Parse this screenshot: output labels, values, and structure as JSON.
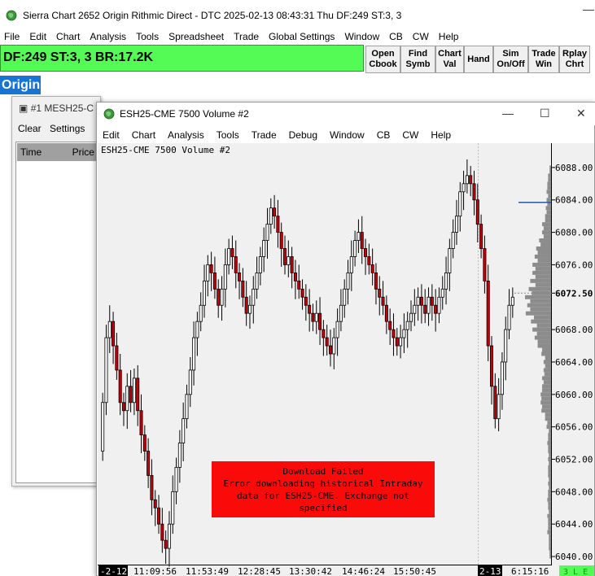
{
  "app": {
    "title": "Sierra Chart 2652 Origin Rithmic Direct - DTC 2025-02-13  08:43:31 Thu DF:249  ST:3, 3",
    "minimize_glyph": "—"
  },
  "menu": [
    "File",
    "Edit",
    "Chart",
    "Analysis",
    "Tools",
    "Spreadsheet",
    "Trade",
    "Global Settings",
    "Window",
    "CB",
    "CW",
    "Help"
  ],
  "status_bar": {
    "text": "DF:249  ST:3, 3  BR:17.2K",
    "color": "#55fb55"
  },
  "toolbar": [
    {
      "label": "Open\nCbook",
      "name": "open-cbook-button"
    },
    {
      "label": "Find\nSymb",
      "name": "find-symb-button"
    },
    {
      "label": "Chart\nVal",
      "name": "chart-val-button"
    },
    {
      "label": "Hand",
      "name": "hand-button"
    },
    {
      "label": "Sim\nOn/Off",
      "name": "sim-onoff-button"
    },
    {
      "label": "Trade\nWin",
      "name": "trade-win-button"
    },
    {
      "label": "Rplay\nChrt",
      "name": "rplay-chrt-button"
    }
  ],
  "origin_label": "Origin",
  "window1": {
    "title": "#1 MESH25-C",
    "menu": [
      "Clear",
      "Settings"
    ],
    "columns": [
      "Time",
      "Price"
    ]
  },
  "window2": {
    "title": "ESH25-CME  7500 Volume #2",
    "menu": [
      "Edit",
      "Chart",
      "Analysis",
      "Tools",
      "Trade",
      "Debug",
      "Window",
      "CB",
      "CW",
      "Help"
    ],
    "buttons": {
      "minimize": "—",
      "maximize": "☐",
      "close": "✕"
    }
  },
  "chart_data": {
    "type": "candlestick",
    "title": "ESH25-CME  7500 Volume #2",
    "price_labels": [
      "6088.00",
      "6084.00",
      "6080.00",
      "6076.00",
      "6072.50",
      "6068.00",
      "6064.00",
      "6060.00",
      "6056.00",
      "6052.00",
      "6048.00",
      "6044.00",
      "6040.00"
    ],
    "current_price": "6072.50",
    "ylim": [
      6039,
      6091
    ],
    "time_labels": [
      "-2-12",
      "11:09:56",
      "11:53:49",
      "12:28:45",
      "13:30:42",
      "14:46:24",
      "15:50:45",
      "2-13",
      "6:15:16"
    ],
    "status_right": "3 L E",
    "error_box": {
      "line1": "Download Failed",
      "line2": "Error downloading historical Intraday",
      "line3": "data for ESH25-CME. Exchange not",
      "line4": "specified",
      "color": "#fb0a0a"
    },
    "colors": {
      "up": "#ffffff",
      "down": "#c8000a",
      "profile": "#8c8c8c",
      "highlight": "#55fb55"
    },
    "closes": [
      6059,
      6067,
      6069,
      6066,
      6063,
      6059,
      6058,
      6061,
      6059,
      6062,
      6058,
      6055,
      6053,
      6050,
      6047,
      6046,
      6044,
      6042,
      6041,
      6044,
      6048,
      6051,
      6054,
      6057,
      6060,
      6063,
      6067,
      6069,
      6071,
      6074,
      6076,
      6075,
      6073,
      6071,
      6073,
      6076,
      6078,
      6077,
      6075,
      6074,
      6072,
      6070,
      6071,
      6073,
      6075,
      6077,
      6079,
      6081,
      6083,
      6082,
      6080,
      6078,
      6076,
      6077,
      6075,
      6074,
      6073,
      6072,
      6071,
      6070,
      6069,
      6070,
      6068,
      6067,
      6066,
      6065,
      6067,
      6069,
      6071,
      6073,
      6075,
      6077,
      6079,
      6080,
      6078,
      6077,
      6076,
      6075,
      6073,
      6072,
      6071,
      6069,
      6068,
      6067,
      6066,
      6067,
      6068,
      6069,
      6070,
      6071,
      6072,
      6071,
      6070,
      6072,
      6071,
      6070,
      6072,
      6073,
      6075,
      6078,
      6080,
      6082,
      6085,
      6086,
      6087,
      6086,
      6084,
      6081,
      6078,
      6074,
      6066,
      6061,
      6057,
      6060,
      6064,
      6068,
      6071,
      6072
    ]
  }
}
